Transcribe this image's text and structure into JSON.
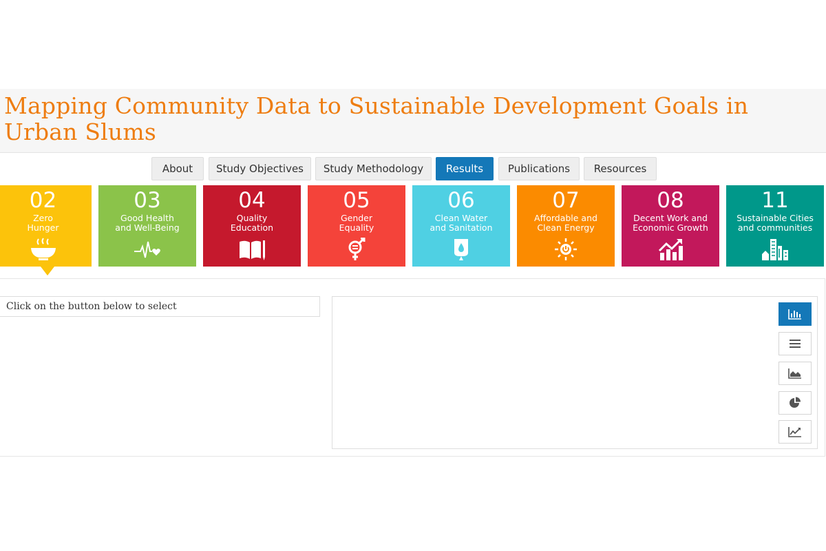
{
  "header": {
    "title": "Mapping Community Data to Sustainable Development Goals in Urban Slums"
  },
  "nav": {
    "tabs": [
      {
        "label": "About",
        "active": false
      },
      {
        "label": "Study Objectives",
        "active": false
      },
      {
        "label": "Study Methodology",
        "active": false
      },
      {
        "label": "Results",
        "active": true
      },
      {
        "label": "Publications",
        "active": false
      },
      {
        "label": "Resources",
        "active": false
      }
    ]
  },
  "goals": [
    {
      "number": "02",
      "line1": "Zero",
      "line2": "Hunger",
      "color": "#fcc30b",
      "icon": "bowl-icon",
      "selected": true
    },
    {
      "number": "03",
      "line1": "Good Health",
      "line2": "and Well-Being",
      "color": "#8bc34a",
      "icon": "heartbeat-icon",
      "selected": false
    },
    {
      "number": "04",
      "line1": "Quality",
      "line2": "Education",
      "color": "#c5192d",
      "icon": "book-icon",
      "selected": false
    },
    {
      "number": "05",
      "line1": "Gender",
      "line2": "Equality",
      "color": "#f4433a",
      "icon": "gender-icon",
      "selected": false
    },
    {
      "number": "06",
      "line1": "Clean Water",
      "line2": "and Sanitation",
      "color": "#4fd0e3",
      "icon": "water-icon",
      "selected": false
    },
    {
      "number": "07",
      "line1": "Affordable and",
      "line2": "Clean Energy",
      "color": "#fb8b00",
      "icon": "sun-power-icon",
      "selected": false
    },
    {
      "number": "08",
      "line1": "Decent Work and",
      "line2": "Economic Growth",
      "color": "#c2185b",
      "icon": "growth-chart-icon",
      "selected": false
    },
    {
      "number": "11",
      "line1": "Sustainable Cities",
      "line2": "and communities",
      "color": "#00988a",
      "icon": "city-icon",
      "selected": false
    }
  ],
  "selector": {
    "text": "Click on the button below to select"
  },
  "chart_types": [
    {
      "icon": "bar-chart-icon",
      "active": true
    },
    {
      "icon": "list-icon",
      "active": false
    },
    {
      "icon": "area-chart-icon",
      "active": false
    },
    {
      "icon": "pie-chart-icon",
      "active": false
    },
    {
      "icon": "line-chart-icon",
      "active": false
    }
  ],
  "colors": {
    "title": "#ee7d11",
    "active_tab": "#1478b8"
  }
}
